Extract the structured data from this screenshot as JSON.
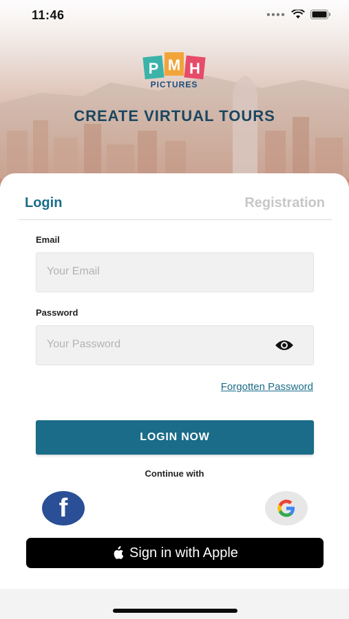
{
  "status_bar": {
    "time": "11:46",
    "icons": [
      "signal-icon",
      "wifi-icon",
      "battery-icon"
    ]
  },
  "logo": {
    "letters": [
      "P",
      "M",
      "H"
    ],
    "word": "PICTURES",
    "colors": [
      "#3bb3a8",
      "#f2a43a",
      "#e84b6a"
    ]
  },
  "headline": "CREATE VIRTUAL TOURS",
  "tabs": {
    "login": "Login",
    "registration": "Registration",
    "active": "login"
  },
  "form": {
    "email_label": "Email",
    "email_placeholder": "Your Email",
    "password_label": "Password",
    "password_placeholder": "Your Password",
    "forgot": "Forgotten Password",
    "submit": "LOGIN NOW",
    "continue_with": "Continue with"
  },
  "social": {
    "facebook_icon": "facebook-icon",
    "google_icon": "google-icon",
    "apple_label": "Sign in with Apple"
  },
  "colors": {
    "primary": "#1a6c88",
    "heading": "#1b4660",
    "facebook": "#2a4f96"
  }
}
